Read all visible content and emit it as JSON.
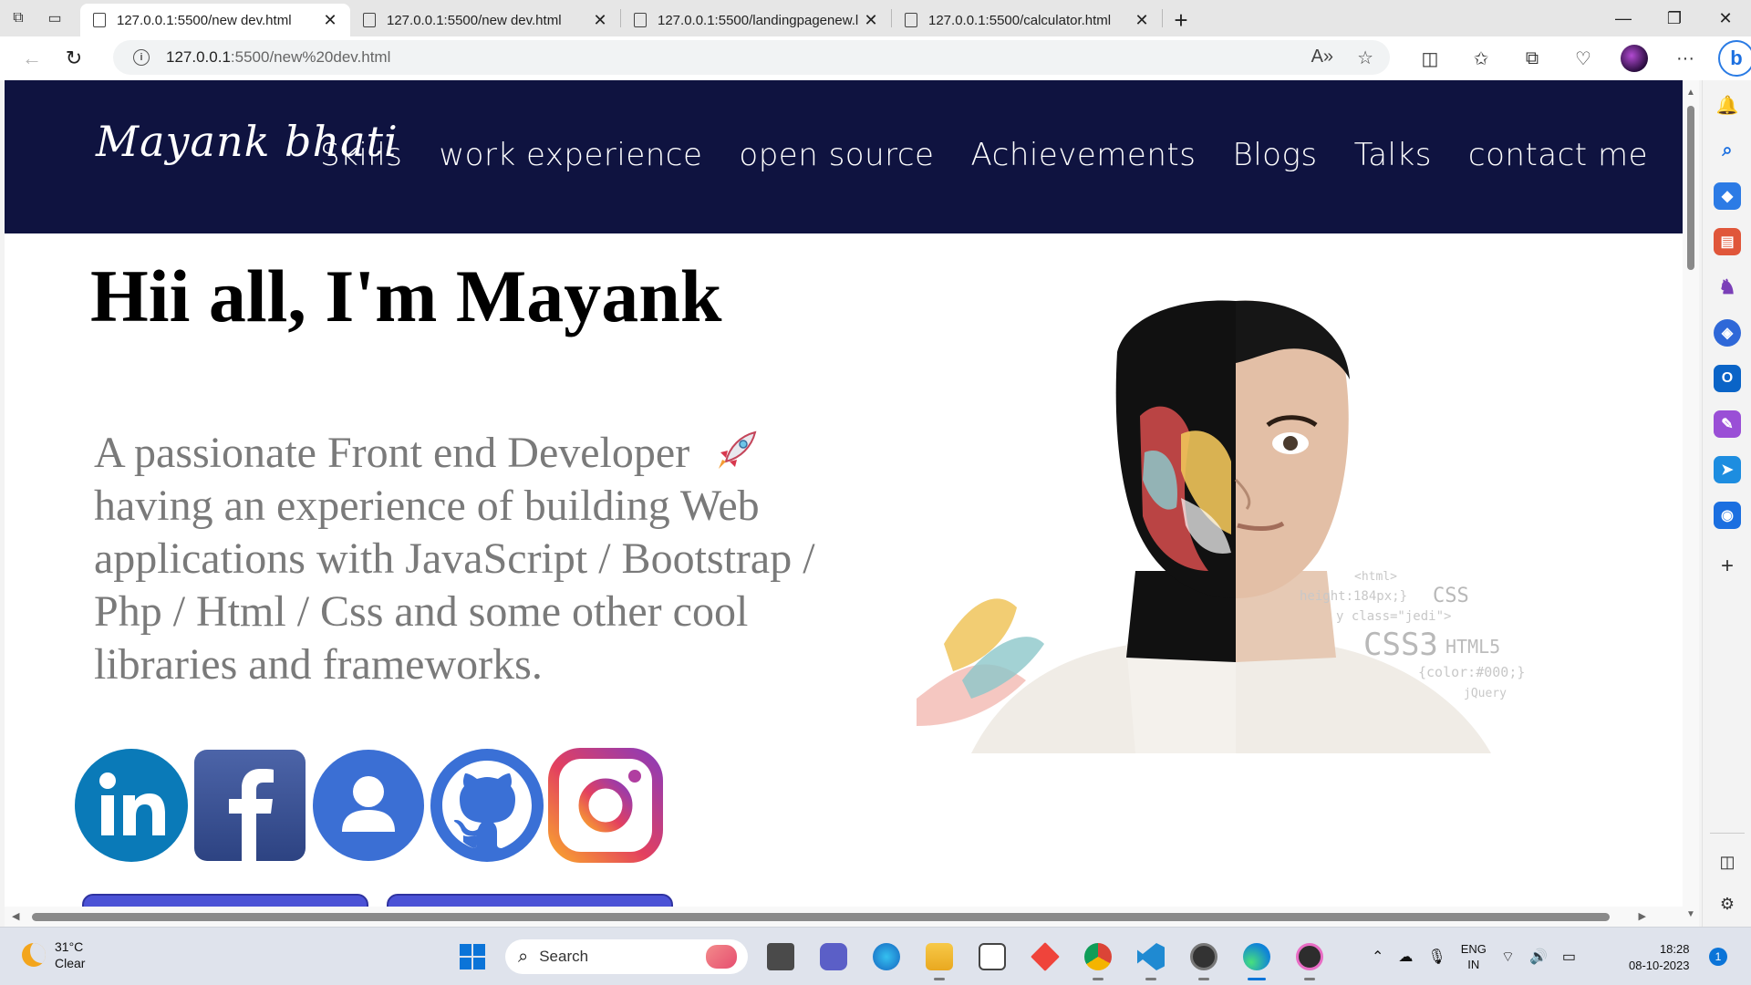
{
  "browser": {
    "tabs": [
      {
        "title": "127.0.0.1:5500/new dev.html",
        "active": true
      },
      {
        "title": "127.0.0.1:5500/new dev.html",
        "active": false
      },
      {
        "title": "127.0.0.1:5500/landingpagenew.l",
        "active": false
      },
      {
        "title": "127.0.0.1:5500/calculator.html",
        "active": false
      }
    ],
    "url_host": "127.0.0.1",
    "url_rest": ":5500/new%20dev.html"
  },
  "site": {
    "logo": "Mayank bhati",
    "nav": [
      "Skills",
      "work experience",
      "open source",
      "Achievements",
      "Blogs",
      "Talks",
      "contact me"
    ],
    "hero_title": "Hii all, I'm Mayank",
    "hero_description": "A passionate Front end Developer",
    "hero_description_rest": "having an experience of building Web applications with JavaScript / Bootstrap / Php / Html / Css and some other cool libraries and frameworks.",
    "art_code_lines": [
      "<html>",
      "height:184px;}",
      "CSS",
      "y class=\"jedi\">",
      "CSS3",
      "HTML5",
      "{color:#000;}",
      "jQuery"
    ],
    "social_icons": [
      "linkedin-icon",
      "facebook-icon",
      "google-profile-icon",
      "github-icon",
      "instagram-icon"
    ],
    "colors": {
      "header_bg": "#0f1340",
      "button_bg": "#4b52d6",
      "desc_text": "#7a7a7a"
    }
  },
  "taskbar": {
    "weather_temp": "31°C",
    "weather_desc": "Clear",
    "search_placeholder": "Search",
    "lang_top": "ENG",
    "lang_bottom": "IN",
    "time": "18:28",
    "date": "08-10-2023",
    "notification_count": "1"
  }
}
